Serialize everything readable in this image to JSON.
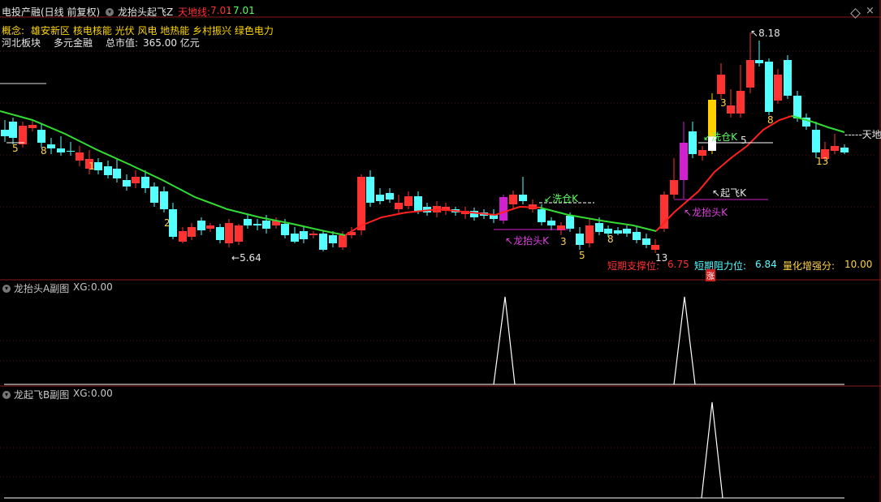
{
  "header": {
    "stock_title": "电投产融(日线 前复权)",
    "indicator_name": "龙抬头起飞Z",
    "tiandi_label": "天地线:",
    "tiandi_value1": "7.01",
    "tiandi_value2": "7.01"
  },
  "info": {
    "concept_label": "概念:",
    "concepts": "雄安新区 核电核能 光伏 风电 地热能 乡村振兴 绿色电力",
    "region": "河北板块",
    "industry": "多元金融",
    "mcap_label": "总市值:",
    "mcap_value": "365.00 亿元"
  },
  "main_chart": {
    "high_label": "8.18",
    "low_label": "5.64",
    "tiandi_right_label": "天地",
    "support_label": "短期支撑位:",
    "support_value": "6.75",
    "resist_label": "短期阻力位:",
    "resist_value": "6.84",
    "strength_label": "量化增强分:",
    "strength_value": "10.00",
    "zhang_badge": "涨",
    "annotations": {
      "xicang1": "洗仓K",
      "longtaitou1": "龙抬头K",
      "xicang2": "洗仓K",
      "qifei": "起飞K",
      "longtaitou2": "龙抬头K"
    },
    "candle_numbers": [
      "5",
      "8",
      "1",
      "2",
      "3",
      "5",
      "8",
      "13",
      "3",
      "8",
      "5",
      "13"
    ]
  },
  "sub_panel_a": {
    "title": "龙抬头A副图",
    "xg_label": "XG:",
    "xg_value": "0.00"
  },
  "sub_panel_b": {
    "title": "龙起飞B副图",
    "xg_label": "XG:",
    "xg_value": "0.00"
  },
  "colors": {
    "up": "#ff3232",
    "down": "#54ffff",
    "ma_green": "#32dc32",
    "ma_red": "#ff2020",
    "magenta": "#d020d0",
    "yellow": "#ffd000",
    "panel_border": "#8b1a1a"
  }
}
